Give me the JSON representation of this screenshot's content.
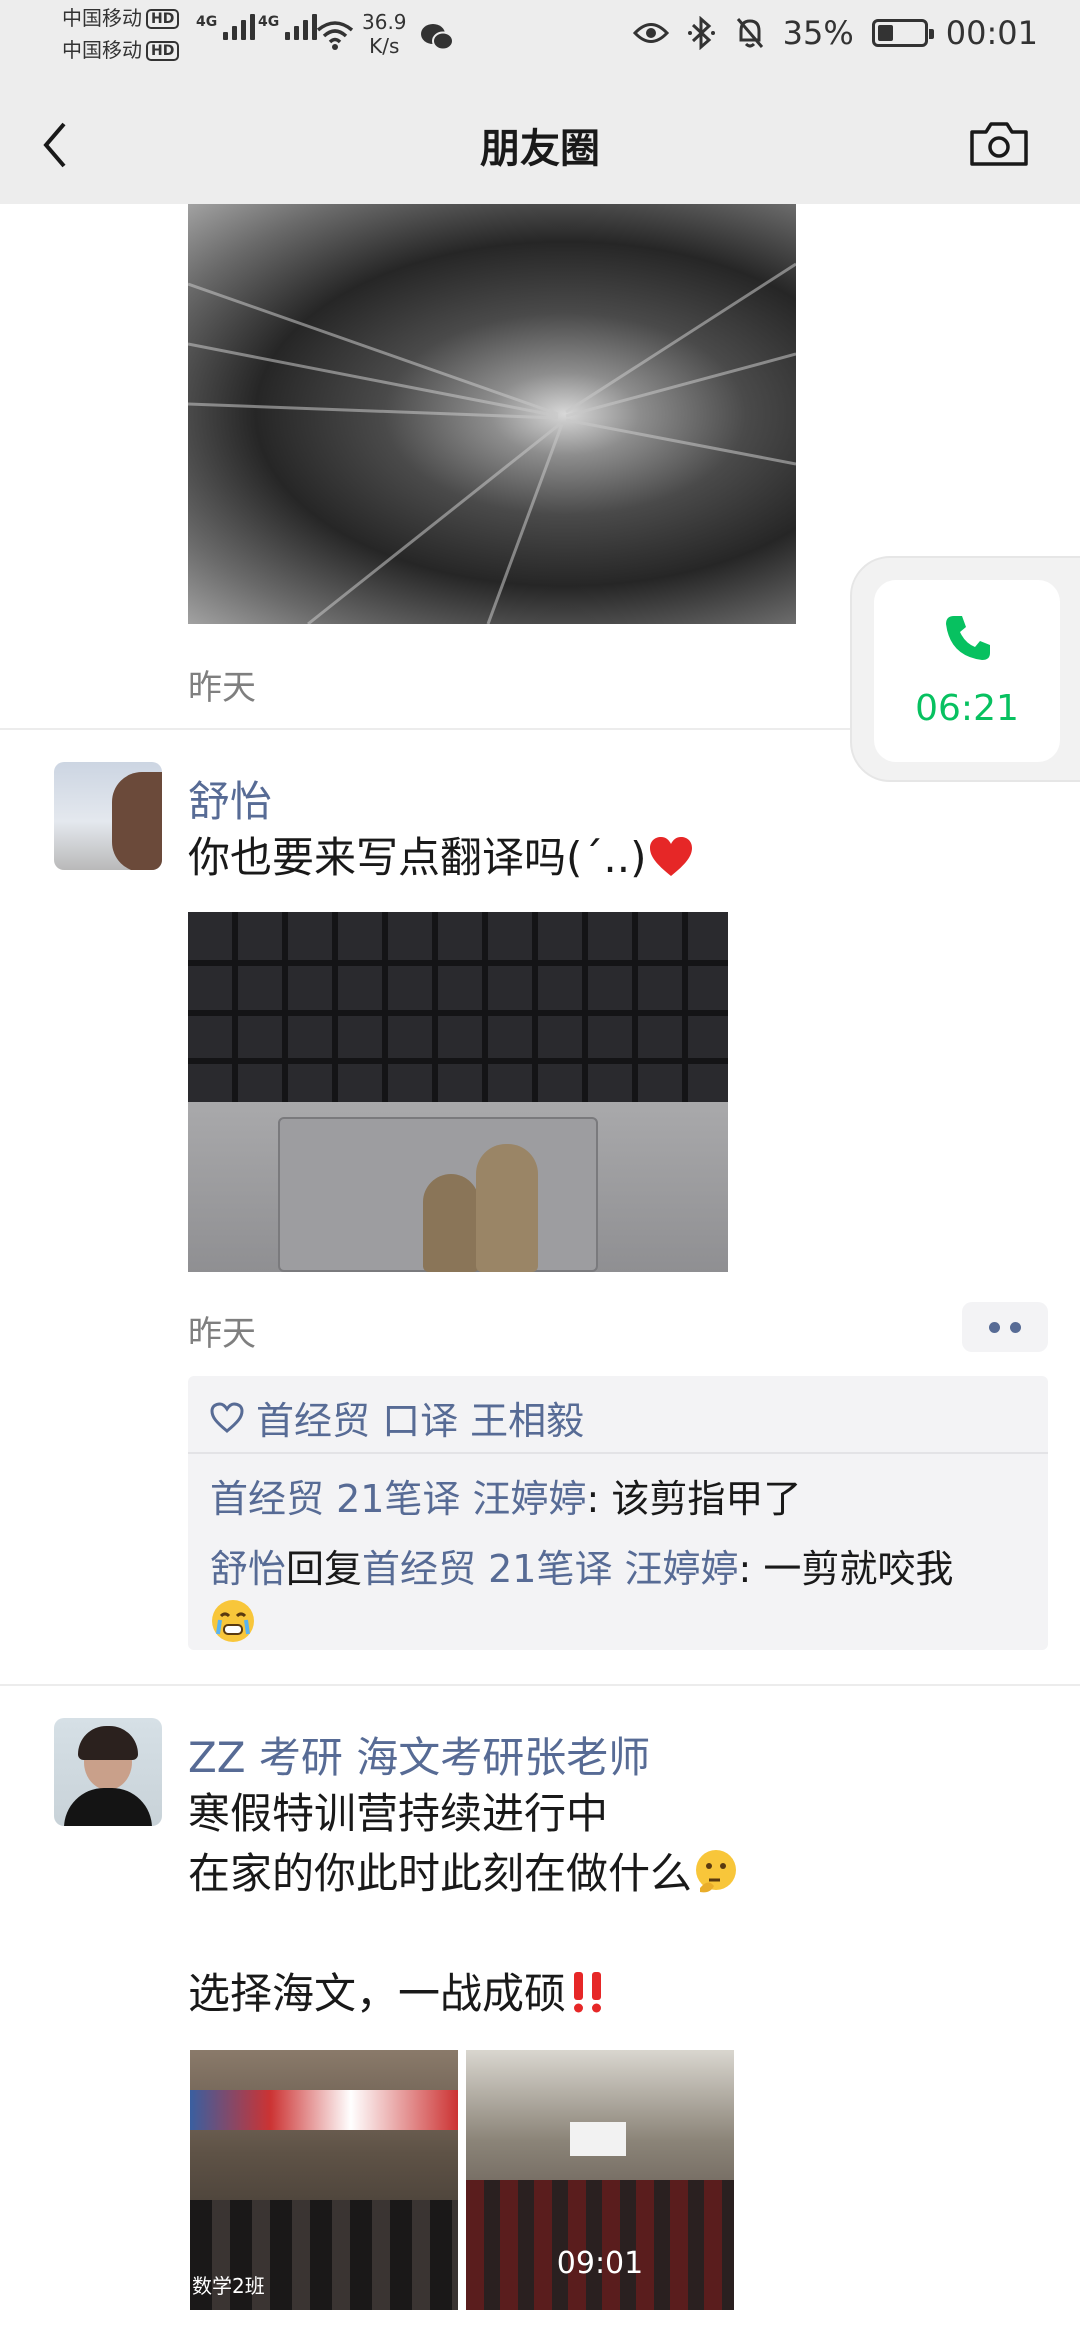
{
  "status_bar": {
    "carrier1": "中国移动",
    "carrier2": "中国移动",
    "hd_badge": "HD",
    "signal1_label": "4G",
    "signal2_label": "4G",
    "net_speed_value": "36.9",
    "net_speed_unit": "K/s",
    "battery_percent": "35%",
    "battery_level": 0.35,
    "time": "00:01",
    "icons": [
      "wifi-icon",
      "wechat-icon",
      "eye-icon",
      "bluetooth-icon",
      "mute-icon",
      "battery-icon"
    ]
  },
  "nav": {
    "title": "朋友圈",
    "back_icon": "chevron-left-icon",
    "camera_icon": "camera-icon"
  },
  "call_float": {
    "duration": "06:21",
    "icon": "phone-icon",
    "color": "#07c160"
  },
  "feed": {
    "post0": {
      "time": "昨天"
    },
    "post1": {
      "name": "舒怡",
      "text": "你也要来写点翻译吗(´..)",
      "emoji": "red-heart",
      "time": "昨天",
      "likes_icon": "heart-outline-icon",
      "likes": "首经贸 口译 王相毅",
      "comments": [
        {
          "author": "首经贸 21笔译 汪婷婷",
          "text": ": 该剪指甲了"
        },
        {
          "author": "舒怡",
          "reply_word": "回复",
          "reply_to": "首经贸 21笔译 汪婷婷",
          "text": ": 一剪就咬我",
          "emoji": "crying-face"
        }
      ]
    },
    "post2": {
      "name": "ZZ 考研 海文考研张老师",
      "line1": "寒假特训营持续进行中",
      "line2": "在家的你此时此刻在做什么",
      "line2_emoji": "thinking-face",
      "line3": "选择海文，一战成硕",
      "line3_emoji": "double-exclamation",
      "video_duration": "09:01",
      "photo1_caption": "数学2班"
    }
  },
  "colors": {
    "link": "#576b95",
    "accent_green": "#07c160",
    "bar_bg": "#ededed"
  }
}
